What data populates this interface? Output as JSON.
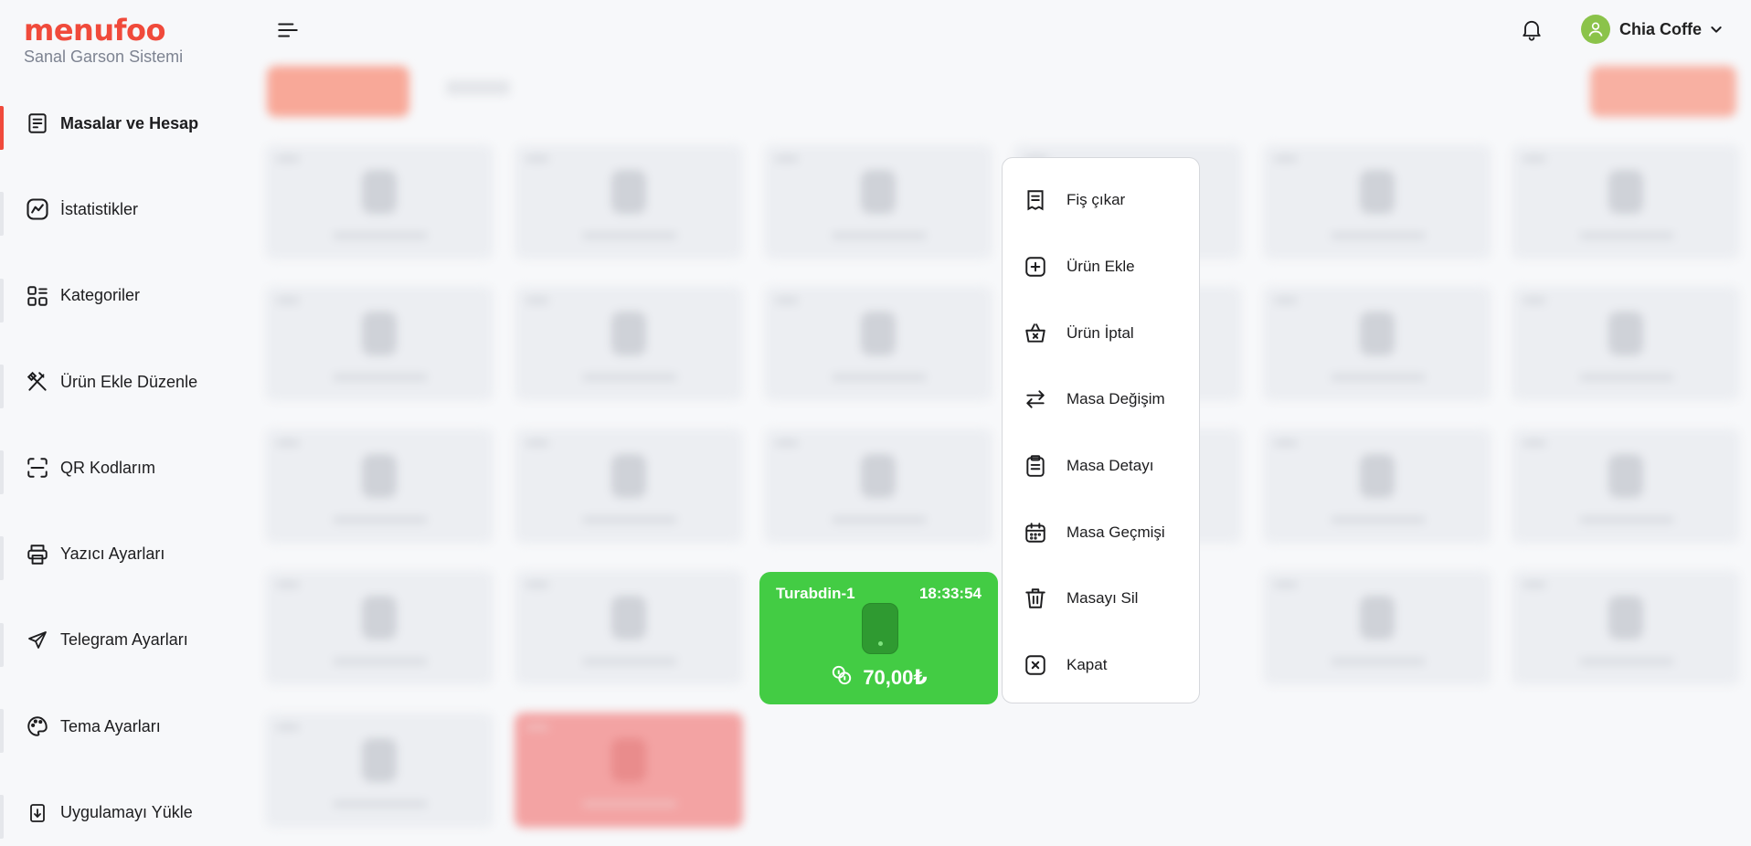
{
  "brand": {
    "name": "menufoo",
    "tagline": "Sanal Garson Sistemi",
    "accent_color": "#f04a3b"
  },
  "sidebar": {
    "items": [
      {
        "label": "Masalar ve Hesap",
        "icon": "receipt-icon",
        "active": true
      },
      {
        "label": "İstatistikler",
        "icon": "chart-icon",
        "active": false
      },
      {
        "label": "Kategoriler",
        "icon": "categories-icon",
        "active": false
      },
      {
        "label": "Ürün Ekle Düzenle",
        "icon": "utensils-icon",
        "active": false
      },
      {
        "label": "QR Kodlarım",
        "icon": "qr-scan-icon",
        "active": false
      },
      {
        "label": "Yazıcı Ayarları",
        "icon": "printer-icon",
        "active": false
      },
      {
        "label": "Telegram Ayarları",
        "icon": "send-icon",
        "active": false
      },
      {
        "label": "Tema Ayarları",
        "icon": "palette-icon",
        "active": false
      },
      {
        "label": "Uygulamayı Yükle",
        "icon": "download-icon",
        "active": false
      }
    ]
  },
  "header": {
    "user_name": "Chia Coffe"
  },
  "active_table": {
    "name": "Turabdin-1",
    "time": "18:33:54",
    "total": "70,00₺",
    "color": "#43cc44"
  },
  "context_menu": {
    "items": [
      {
        "label": "Fiş çıkar",
        "icon": "receipt-icon"
      },
      {
        "label": "Ürün Ekle",
        "icon": "plus-square-icon"
      },
      {
        "label": "Ürün İptal",
        "icon": "basket-cancel-icon"
      },
      {
        "label": "Masa Değişim",
        "icon": "swap-arrows-icon"
      },
      {
        "label": "Masa Detayı",
        "icon": "clipboard-icon"
      },
      {
        "label": "Masa Geçmişi",
        "icon": "calendar-icon"
      },
      {
        "label": "Masayı Sil",
        "icon": "trash-icon"
      },
      {
        "label": "Kapat",
        "icon": "close-square-icon"
      }
    ]
  }
}
